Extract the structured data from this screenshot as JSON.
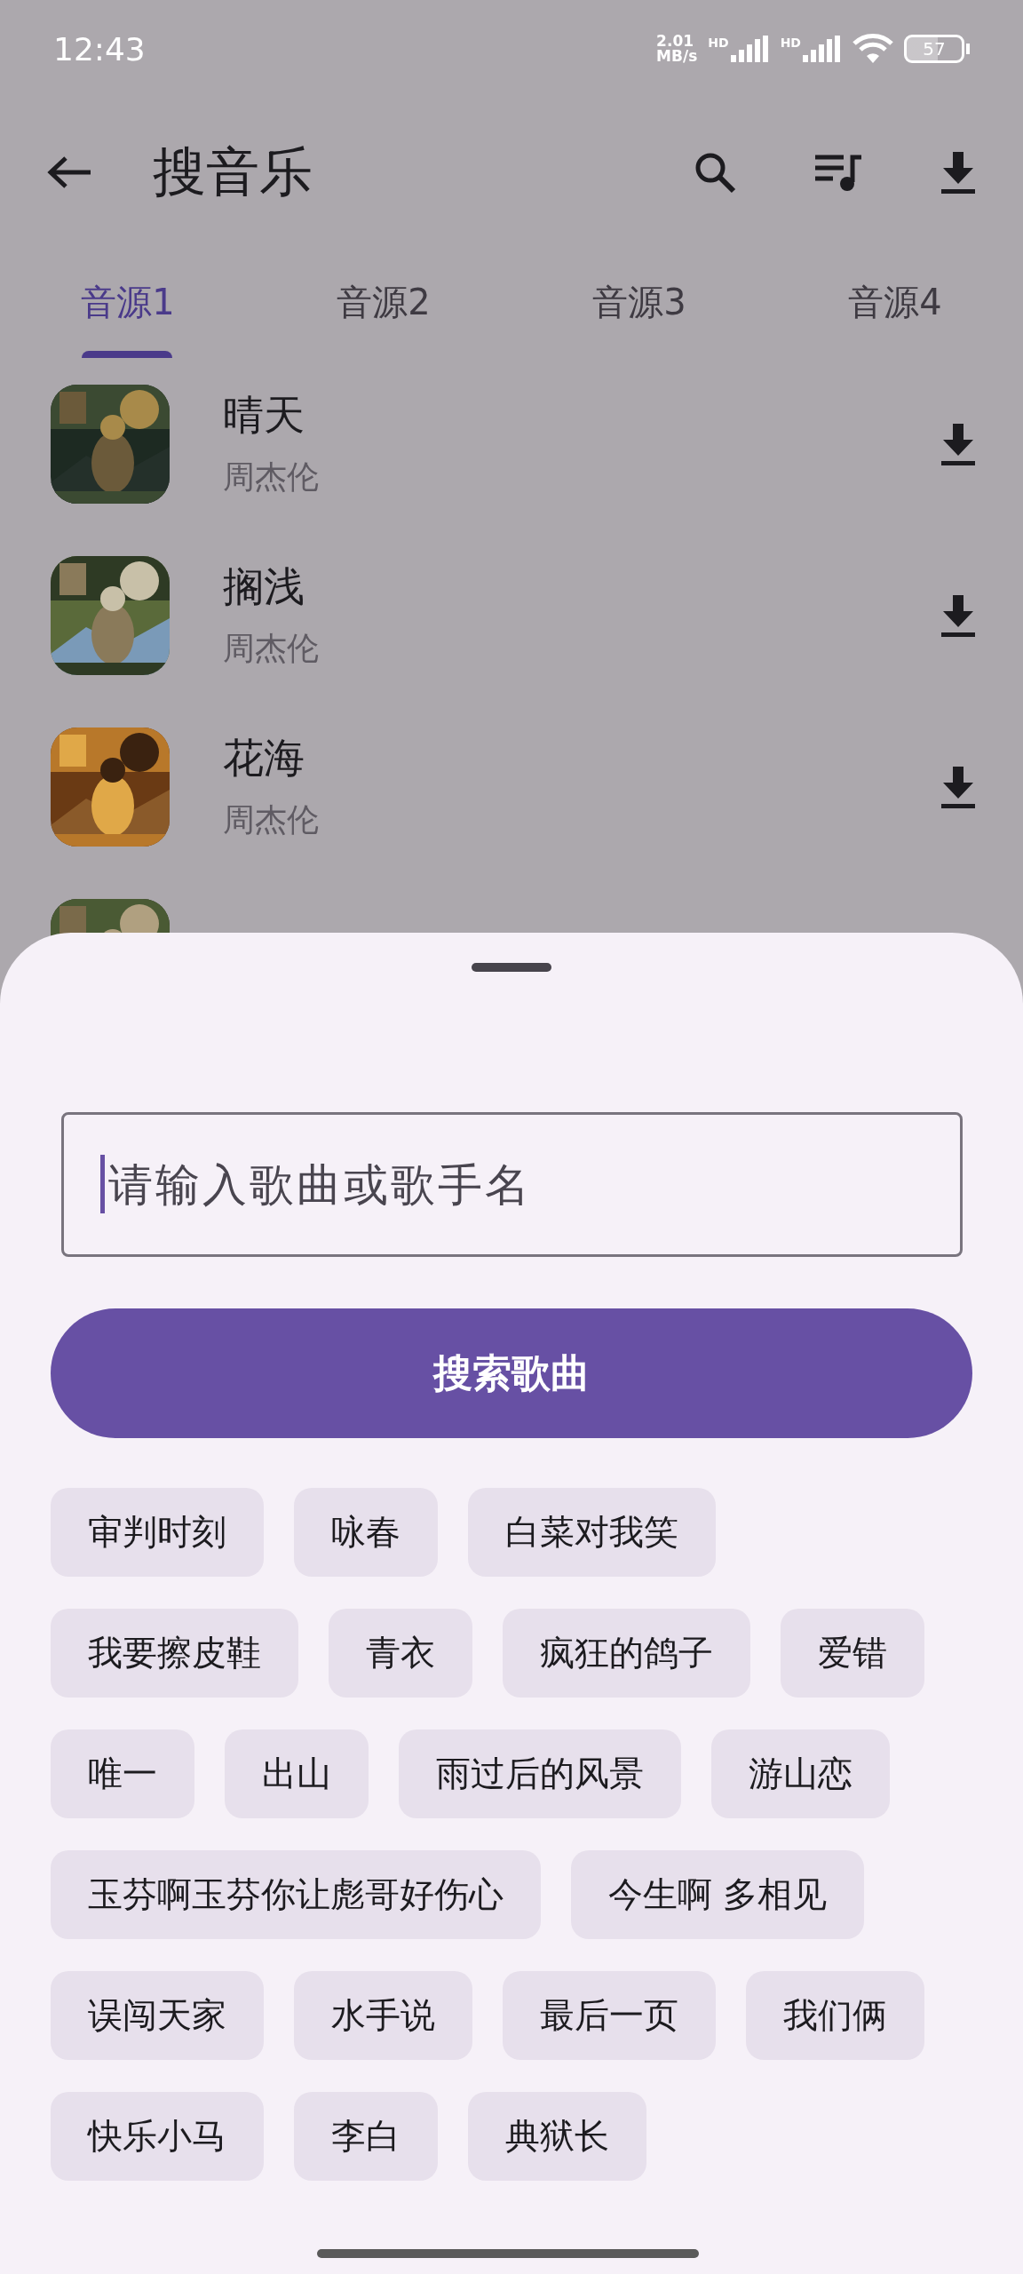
{
  "status_bar": {
    "time": "12:43",
    "speed": [
      "2.01",
      "MB/s"
    ],
    "sim_labels": [
      "HD",
      "HD"
    ],
    "battery": "57"
  },
  "app_bar": {
    "title": "搜音乐"
  },
  "tabs": [
    {
      "label": "音源1",
      "selected": true
    },
    {
      "label": "音源2",
      "selected": false
    },
    {
      "label": "音源3",
      "selected": false
    },
    {
      "label": "音源4",
      "selected": false
    }
  ],
  "songs": [
    {
      "kind": "song",
      "title": "晴天",
      "artist": "周杰伦"
    },
    {
      "kind": "song",
      "title": "搁浅",
      "artist": "周杰伦"
    },
    {
      "kind": "song",
      "title": "花海",
      "artist": "周杰伦"
    },
    {
      "kind": "cover_only"
    }
  ],
  "sheet": {
    "search": {
      "placeholder": "请输入歌曲或歌手名"
    },
    "button": "搜索歌曲",
    "suggestions": [
      "审判时刻",
      "咏春",
      "白菜对我笑",
      "我要擦皮鞋",
      "青衣",
      "疯狂的鸽子",
      "爱错",
      "唯一",
      "出山",
      "雨过后的风景",
      "游山恋",
      "玉芬啊玉芬你让彪哥好伤心",
      "今生啊 多相见",
      "误闯天家",
      "水手说",
      "最后一页",
      "我们俩",
      "快乐小马",
      "李白",
      "典狱长"
    ]
  }
}
